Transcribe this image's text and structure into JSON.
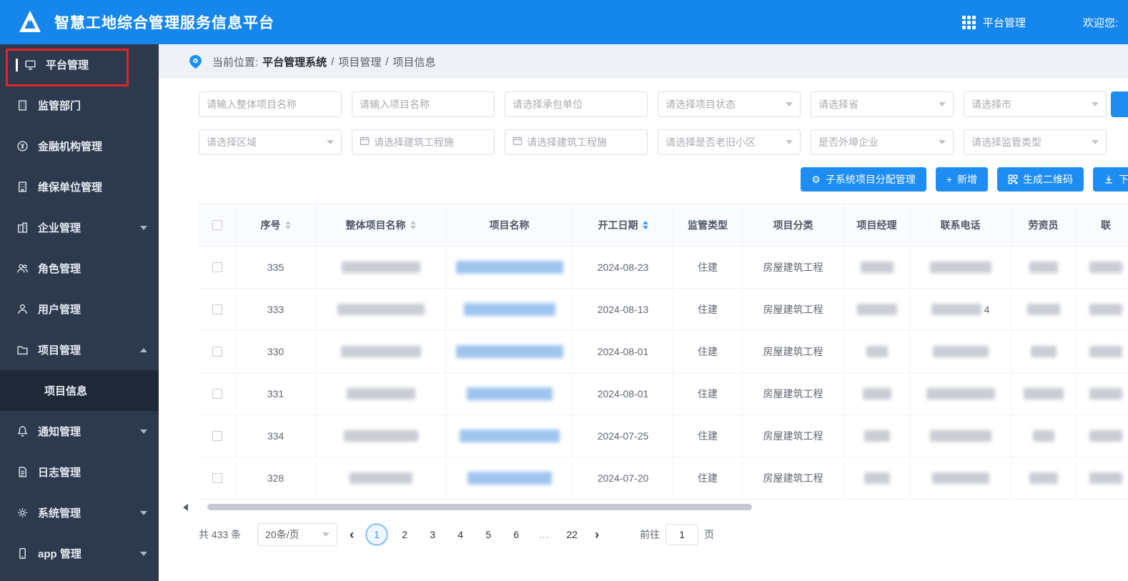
{
  "colors": {
    "header_blue": "#1586ec",
    "accent_blue": "#1e8df2",
    "sidebar_dark": "#2d3a4d",
    "annotation_red": "#e02424"
  },
  "header": {
    "title": "智慧工地综合管理服务信息平台",
    "menu_label": "平台管理",
    "welcome": "欢迎您:"
  },
  "sidebar": {
    "items": [
      {
        "label": "平台管理"
      },
      {
        "label": "监管部门"
      },
      {
        "label": "金融机构管理"
      },
      {
        "label": "维保单位管理"
      },
      {
        "label": "企业管理",
        "arrow": "down"
      },
      {
        "label": "角色管理"
      },
      {
        "label": "用户管理"
      },
      {
        "label": "项目管理",
        "arrow": "up"
      },
      {
        "label": "项目信息",
        "submenu": true,
        "active": true
      },
      {
        "label": "通知管理",
        "arrow": "down"
      },
      {
        "label": "日志管理"
      },
      {
        "label": "系统管理",
        "arrow": "down"
      },
      {
        "label": "app 管理",
        "arrow": "down"
      }
    ]
  },
  "breadcrumb": {
    "prefix": "当前位置:",
    "system": "平台管理系统",
    "sep1": "/",
    "level1": "项目管理",
    "sep2": "/",
    "level2": "项目信息"
  },
  "filters": {
    "row1": [
      {
        "type": "input",
        "placeholder": "请输入整体项目名称"
      },
      {
        "type": "input",
        "placeholder": "请输入项目名称"
      },
      {
        "type": "input",
        "placeholder": "请选择承包单位"
      },
      {
        "type": "select",
        "placeholder": "请选择项目状态"
      },
      {
        "type": "select",
        "placeholder": "请选择省"
      },
      {
        "type": "select",
        "placeholder": "请选择市"
      }
    ],
    "row2": [
      {
        "type": "select",
        "placeholder": "请选择区域"
      },
      {
        "type": "date",
        "placeholder": "请选择建筑工程施"
      },
      {
        "type": "date",
        "placeholder": "请选择建筑工程施"
      },
      {
        "type": "select",
        "placeholder": "请选择是否老旧小区"
      },
      {
        "type": "select",
        "placeholder": "是否外埠企业"
      },
      {
        "type": "select",
        "placeholder": "请选择监管类型"
      }
    ]
  },
  "actions": {
    "assign": "子系统项目分配管理",
    "add": "新增",
    "qrcode": "生成二维码",
    "download": "下载"
  },
  "table": {
    "columns": [
      {
        "label": "序号",
        "sortable": true
      },
      {
        "label": "整体项目名称",
        "sortable": true
      },
      {
        "label": "项目名称"
      },
      {
        "label": "开工日期",
        "sortable": true,
        "sort_active": true
      },
      {
        "label": "监管类型"
      },
      {
        "label": "项目分类"
      },
      {
        "label": "项目经理"
      },
      {
        "label": "联系电话"
      },
      {
        "label": "劳资员"
      },
      {
        "label": "联"
      }
    ],
    "rows": [
      {
        "seq": "335",
        "start_date": "2024-08-23",
        "supervision": "住建",
        "category": "房屋建筑工程"
      },
      {
        "seq": "333",
        "start_date": "2024-08-13",
        "supervision": "住建",
        "category": "房屋建筑工程",
        "phone_tail": "4"
      },
      {
        "seq": "330",
        "start_date": "2024-08-01",
        "supervision": "住建",
        "category": "房屋建筑工程"
      },
      {
        "seq": "331",
        "start_date": "2024-08-01",
        "supervision": "住建",
        "category": "房屋建筑工程"
      },
      {
        "seq": "334",
        "start_date": "2024-07-25",
        "supervision": "住建",
        "category": "房屋建筑工程"
      },
      {
        "seq": "328",
        "start_date": "2024-07-20",
        "supervision": "住建",
        "category": "房屋建筑工程"
      }
    ]
  },
  "pagination": {
    "total": "共 433 条",
    "page_size": "20条/页",
    "pages": [
      "1",
      "2",
      "3",
      "4",
      "5",
      "6",
      "...",
      "22"
    ],
    "active_page": "1",
    "goto_label": "前往",
    "goto_value": "1",
    "goto_unit": "页"
  }
}
